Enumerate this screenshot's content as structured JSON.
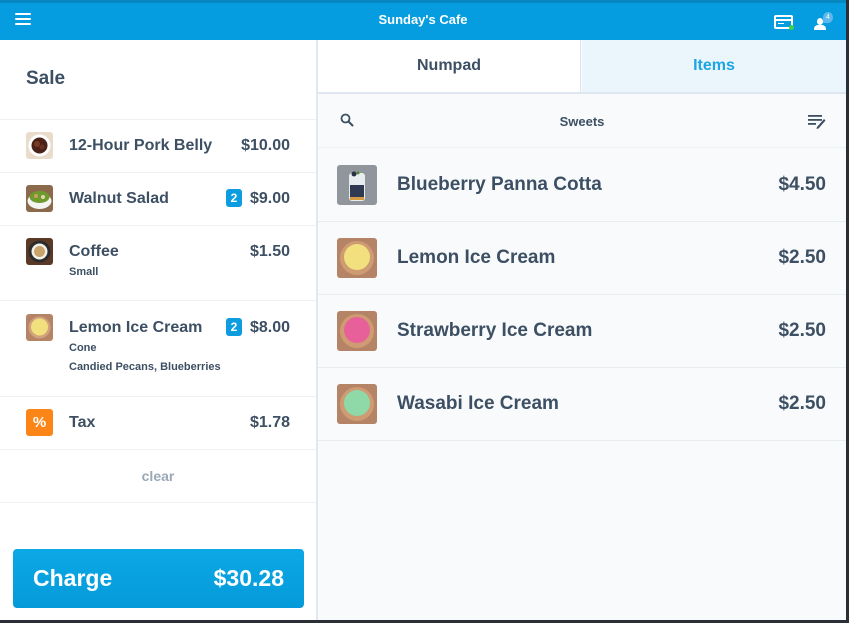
{
  "header": {
    "title": "Sunday's Cafe",
    "menu_icon": "hamburger-menu-icon",
    "card_reader_icon": "card-reader-icon",
    "card_reader_status_color": "#3fd14a",
    "customer_icon": "customer-icon",
    "customer_badge": "4"
  },
  "sale": {
    "title": "Sale",
    "items": [
      {
        "name": "12-Hour Pork Belly",
        "price": "$10.00",
        "quantity": null,
        "modifiers": []
      },
      {
        "name": "Walnut Salad",
        "price": "$9.00",
        "quantity": "2",
        "modifiers": []
      },
      {
        "name": "Coffee",
        "price": "$1.50",
        "quantity": null,
        "modifiers": [
          "Small"
        ]
      },
      {
        "name": "Lemon Ice Cream",
        "price": "$8.00",
        "quantity": "2",
        "modifiers": [
          "Cone",
          "Candied Pecans, Blueberries"
        ]
      }
    ],
    "tax": {
      "icon": "%",
      "label": "Tax",
      "amount": "$1.78"
    },
    "clear_label": "clear",
    "charge": {
      "label": "Charge",
      "amount": "$30.28"
    }
  },
  "tabs": [
    {
      "label": "Numpad",
      "active": false
    },
    {
      "label": "Items",
      "active": true
    }
  ],
  "filter": {
    "category": "Sweets"
  },
  "catalog": [
    {
      "name": "Blueberry Panna Cotta",
      "price": "$4.50"
    },
    {
      "name": "Lemon Ice Cream",
      "price": "$2.50"
    },
    {
      "name": "Strawberry Ice Cream",
      "price": "$2.50"
    },
    {
      "name": "Wasabi Ice Cream",
      "price": "$2.50"
    }
  ],
  "colors": {
    "brand": "#059ddf",
    "text": "#3d4f63",
    "tax": "#fb8617",
    "active_tab_text": "#1da5e4"
  }
}
